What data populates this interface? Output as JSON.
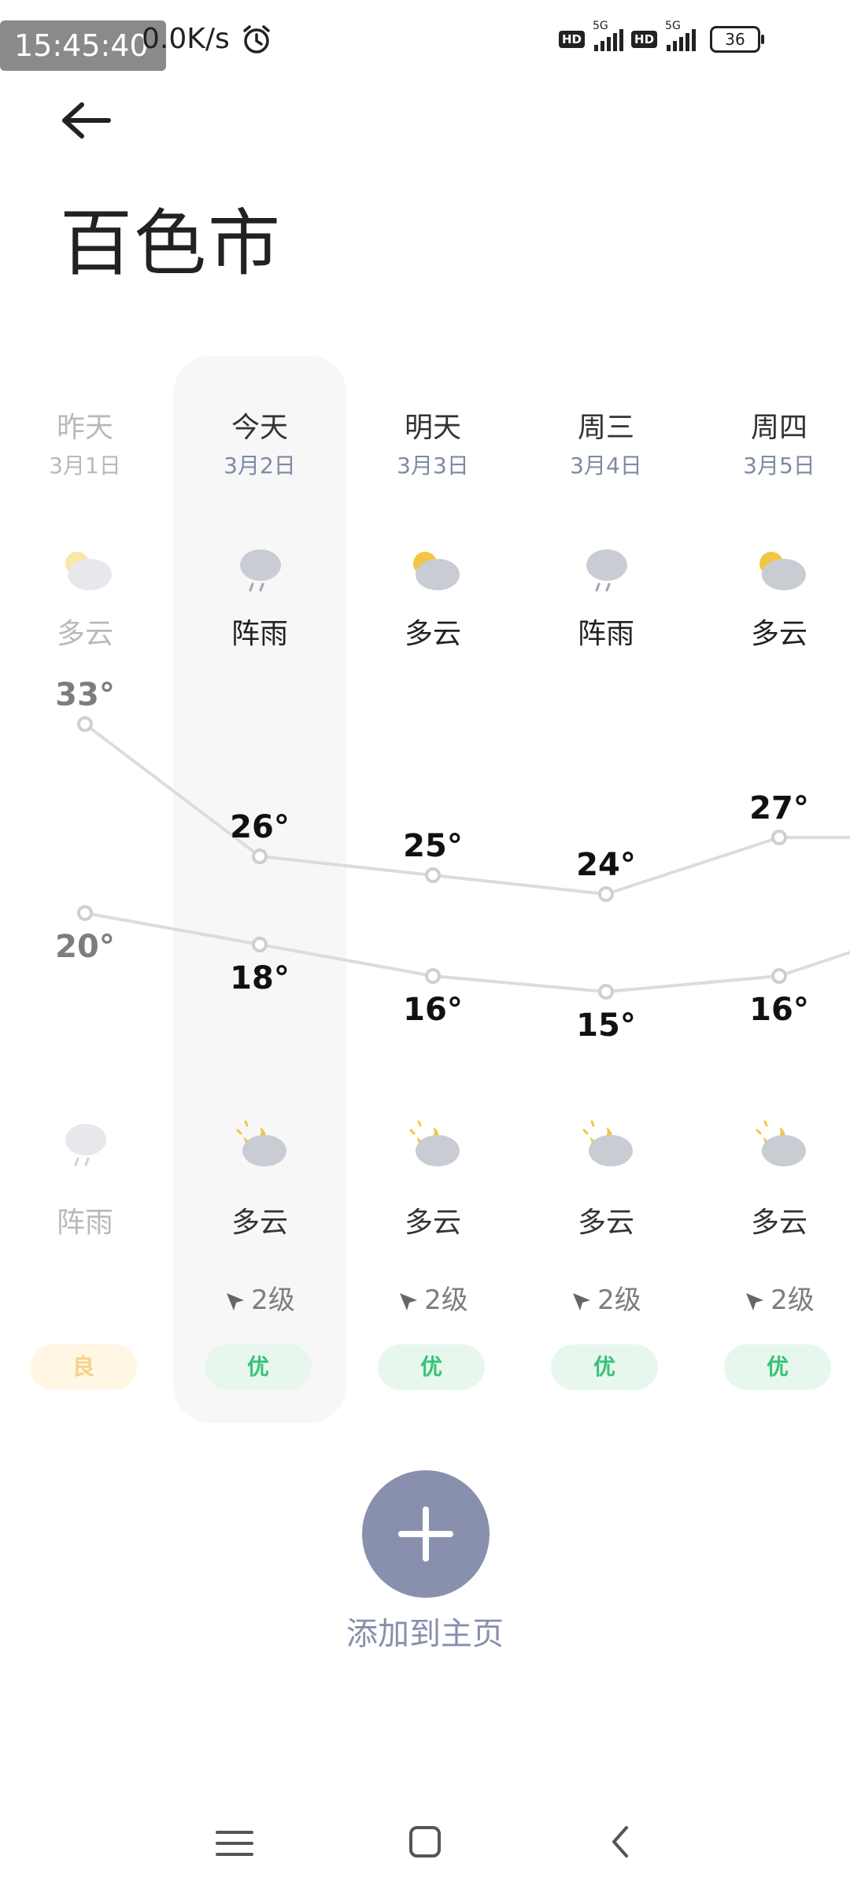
{
  "status_bar": {
    "time": "15:45:40",
    "net_speed": "0.0K/s",
    "hd_label": "HD",
    "network_type": "5G",
    "battery": "36"
  },
  "header": {
    "back_icon": "arrow-left-icon",
    "city": "百色市"
  },
  "forecast": [
    {
      "day": "昨天",
      "date": "3月1日",
      "day_condition": "多云",
      "day_icon": "partly-cloudy-icon",
      "high": "33°",
      "low": "20°",
      "night_condition": "阵雨",
      "night_icon": "shower-icon",
      "wind": "",
      "aqi": "良",
      "past": true
    },
    {
      "day": "今天",
      "date": "3月2日",
      "day_condition": "阵雨",
      "day_icon": "shower-icon",
      "high": "26°",
      "low": "18°",
      "night_condition": "多云",
      "night_icon": "partly-cloudy-night-icon",
      "wind": "2级",
      "aqi": "优",
      "past": false
    },
    {
      "day": "明天",
      "date": "3月3日",
      "day_condition": "多云",
      "day_icon": "partly-cloudy-icon",
      "high": "25°",
      "low": "16°",
      "night_condition": "多云",
      "night_icon": "partly-cloudy-night-icon",
      "wind": "2级",
      "aqi": "优",
      "past": false
    },
    {
      "day": "周三",
      "date": "3月4日",
      "day_condition": "阵雨",
      "day_icon": "shower-icon",
      "high": "24°",
      "low": "15°",
      "night_condition": "多云",
      "night_icon": "partly-cloudy-night-icon",
      "wind": "2级",
      "aqi": "优",
      "past": false
    },
    {
      "day": "周四",
      "date": "3月5日",
      "day_condition": "多云",
      "day_icon": "partly-cloudy-icon",
      "high": "27°",
      "low": "16°",
      "night_condition": "多云",
      "night_icon": "partly-cloudy-night-icon",
      "wind": "2级",
      "aqi": "优",
      "past": false
    }
  ],
  "add_to_home": {
    "icon": "plus-icon",
    "label": "添加到主页"
  },
  "nav": {
    "menu_icon": "menu-icon",
    "home_icon": "home-square-icon",
    "back_icon": "back-chevron-icon"
  },
  "colors": {
    "accent": "#8990ad",
    "aqi_good": "#36c375",
    "aqi_moderate": "#f4d28a",
    "line": "#dcdcdc"
  }
}
